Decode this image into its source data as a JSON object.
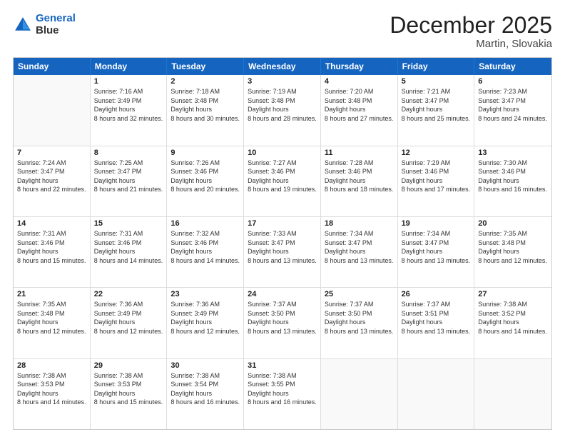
{
  "logo": {
    "line1": "General",
    "line2": "Blue"
  },
  "title": "December 2025",
  "location": "Martin, Slovakia",
  "days": [
    "Sunday",
    "Monday",
    "Tuesday",
    "Wednesday",
    "Thursday",
    "Friday",
    "Saturday"
  ],
  "rows": [
    [
      {
        "day": "",
        "empty": true
      },
      {
        "day": "1",
        "sunrise": "7:16 AM",
        "sunset": "3:49 PM",
        "daylight": "8 hours and 32 minutes."
      },
      {
        "day": "2",
        "sunrise": "7:18 AM",
        "sunset": "3:48 PM",
        "daylight": "8 hours and 30 minutes."
      },
      {
        "day": "3",
        "sunrise": "7:19 AM",
        "sunset": "3:48 PM",
        "daylight": "8 hours and 28 minutes."
      },
      {
        "day": "4",
        "sunrise": "7:20 AM",
        "sunset": "3:48 PM",
        "daylight": "8 hours and 27 minutes."
      },
      {
        "day": "5",
        "sunrise": "7:21 AM",
        "sunset": "3:47 PM",
        "daylight": "8 hours and 25 minutes."
      },
      {
        "day": "6",
        "sunrise": "7:23 AM",
        "sunset": "3:47 PM",
        "daylight": "8 hours and 24 minutes."
      }
    ],
    [
      {
        "day": "7",
        "sunrise": "7:24 AM",
        "sunset": "3:47 PM",
        "daylight": "8 hours and 22 minutes."
      },
      {
        "day": "8",
        "sunrise": "7:25 AM",
        "sunset": "3:47 PM",
        "daylight": "8 hours and 21 minutes."
      },
      {
        "day": "9",
        "sunrise": "7:26 AM",
        "sunset": "3:46 PM",
        "daylight": "8 hours and 20 minutes."
      },
      {
        "day": "10",
        "sunrise": "7:27 AM",
        "sunset": "3:46 PM",
        "daylight": "8 hours and 19 minutes."
      },
      {
        "day": "11",
        "sunrise": "7:28 AM",
        "sunset": "3:46 PM",
        "daylight": "8 hours and 18 minutes."
      },
      {
        "day": "12",
        "sunrise": "7:29 AM",
        "sunset": "3:46 PM",
        "daylight": "8 hours and 17 minutes."
      },
      {
        "day": "13",
        "sunrise": "7:30 AM",
        "sunset": "3:46 PM",
        "daylight": "8 hours and 16 minutes."
      }
    ],
    [
      {
        "day": "14",
        "sunrise": "7:31 AM",
        "sunset": "3:46 PM",
        "daylight": "8 hours and 15 minutes."
      },
      {
        "day": "15",
        "sunrise": "7:31 AM",
        "sunset": "3:46 PM",
        "daylight": "8 hours and 14 minutes."
      },
      {
        "day": "16",
        "sunrise": "7:32 AM",
        "sunset": "3:46 PM",
        "daylight": "8 hours and 14 minutes."
      },
      {
        "day": "17",
        "sunrise": "7:33 AM",
        "sunset": "3:47 PM",
        "daylight": "8 hours and 13 minutes."
      },
      {
        "day": "18",
        "sunrise": "7:34 AM",
        "sunset": "3:47 PM",
        "daylight": "8 hours and 13 minutes."
      },
      {
        "day": "19",
        "sunrise": "7:34 AM",
        "sunset": "3:47 PM",
        "daylight": "8 hours and 13 minutes."
      },
      {
        "day": "20",
        "sunrise": "7:35 AM",
        "sunset": "3:48 PM",
        "daylight": "8 hours and 12 minutes."
      }
    ],
    [
      {
        "day": "21",
        "sunrise": "7:35 AM",
        "sunset": "3:48 PM",
        "daylight": "8 hours and 12 minutes."
      },
      {
        "day": "22",
        "sunrise": "7:36 AM",
        "sunset": "3:49 PM",
        "daylight": "8 hours and 12 minutes."
      },
      {
        "day": "23",
        "sunrise": "7:36 AM",
        "sunset": "3:49 PM",
        "daylight": "8 hours and 12 minutes."
      },
      {
        "day": "24",
        "sunrise": "7:37 AM",
        "sunset": "3:50 PM",
        "daylight": "8 hours and 13 minutes."
      },
      {
        "day": "25",
        "sunrise": "7:37 AM",
        "sunset": "3:50 PM",
        "daylight": "8 hours and 13 minutes."
      },
      {
        "day": "26",
        "sunrise": "7:37 AM",
        "sunset": "3:51 PM",
        "daylight": "8 hours and 13 minutes."
      },
      {
        "day": "27",
        "sunrise": "7:38 AM",
        "sunset": "3:52 PM",
        "daylight": "8 hours and 14 minutes."
      }
    ],
    [
      {
        "day": "28",
        "sunrise": "7:38 AM",
        "sunset": "3:53 PM",
        "daylight": "8 hours and 14 minutes."
      },
      {
        "day": "29",
        "sunrise": "7:38 AM",
        "sunset": "3:53 PM",
        "daylight": "8 hours and 15 minutes."
      },
      {
        "day": "30",
        "sunrise": "7:38 AM",
        "sunset": "3:54 PM",
        "daylight": "8 hours and 16 minutes."
      },
      {
        "day": "31",
        "sunrise": "7:38 AM",
        "sunset": "3:55 PM",
        "daylight": "8 hours and 16 minutes."
      },
      {
        "day": "",
        "empty": true
      },
      {
        "day": "",
        "empty": true
      },
      {
        "day": "",
        "empty": true
      }
    ]
  ]
}
